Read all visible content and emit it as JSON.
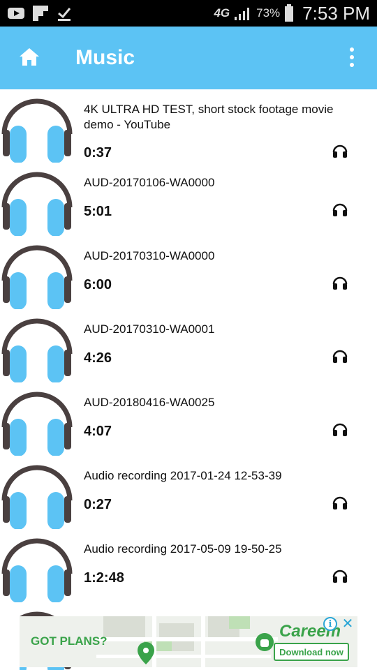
{
  "status_bar": {
    "network": "4G",
    "battery_percent": "73%",
    "time": "7:53 PM",
    "notification_icons": [
      "youtube-icon",
      "flipboard-icon",
      "download-done-icon"
    ]
  },
  "app_bar": {
    "title": "Music",
    "color": "#5cc3f4"
  },
  "tracks": [
    {
      "title": "4K ULTRA HD TEST, short stock footage movie demo - YouTube",
      "duration": "0:37"
    },
    {
      "title": "AUD-20170106-WA0000",
      "duration": "5:01"
    },
    {
      "title": "AUD-20170310-WA0000",
      "duration": "6:00"
    },
    {
      "title": "AUD-20170310-WA0001",
      "duration": "4:26"
    },
    {
      "title": "AUD-20180416-WA0025",
      "duration": "4:07"
    },
    {
      "title": "Audio recording 2017-01-24 12-53-39",
      "duration": "0:27"
    },
    {
      "title": "Audio recording 2017-05-09 19-50-25",
      "duration": "1:2:48"
    }
  ],
  "ad": {
    "headline": "GOT PLANS?",
    "brand": "Careem",
    "cta": "Download now",
    "info_label": "i",
    "close_label": "✕",
    "accent": "#3aa34a"
  }
}
